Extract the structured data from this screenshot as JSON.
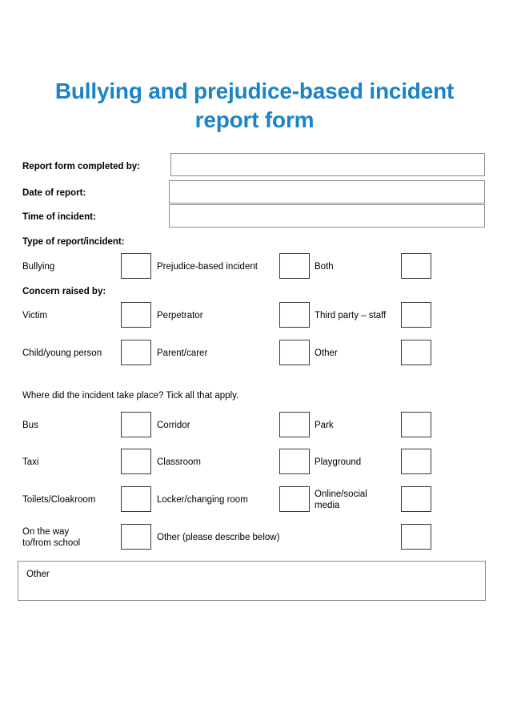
{
  "document": {
    "title_line_1": "Bullying and prejudice-based incident",
    "title_line_2": "report form",
    "title_color": "#1b83c6"
  },
  "header_fields": [
    {
      "label": "Report form completed by:",
      "value": "",
      "placeholder": ""
    },
    {
      "label": "Date of report:",
      "value": "",
      "placeholder": ""
    },
    {
      "label": "Time of incident:",
      "value": "",
      "placeholder": ""
    }
  ],
  "sections": [
    {
      "heading": "Type of report/incident:",
      "rows": [
        {
          "cells": [
            {
              "label": "Bullying",
              "checked": false
            },
            {
              "label": "Prejudice-based incident",
              "checked": false
            },
            {
              "label": "Both",
              "checked": false
            }
          ]
        }
      ]
    },
    {
      "heading": "Concern raised by:",
      "rows": [
        {
          "cells": [
            {
              "label": "Victim",
              "checked": false
            },
            {
              "label": "Perpetrator",
              "checked": false
            },
            {
              "label": "Third party – staff",
              "checked": false
            }
          ]
        },
        {
          "cells": [
            {
              "label": "Child/young person",
              "checked": false
            },
            {
              "label": "Parent/carer",
              "checked": false
            },
            {
              "label": "Other",
              "checked": false
            }
          ]
        }
      ]
    },
    {
      "heading": "Where did the incident take place? Tick all that apply.",
      "heading_bold": false,
      "rows": [
        {
          "cells": [
            {
              "label": "Bus",
              "checked": false
            },
            {
              "label": "Corridor",
              "checked": false
            },
            {
              "label": "Park",
              "checked": false
            }
          ]
        },
        {
          "cells": [
            {
              "label": "Taxi",
              "checked": false
            },
            {
              "label": "Classroom",
              "checked": false
            },
            {
              "label": "Playground",
              "checked": false
            }
          ]
        },
        {
          "cells": [
            {
              "label": "Toilets/Cloakroom",
              "checked": false
            },
            {
              "label": "Locker/changing room",
              "checked": false
            },
            {
              "label": "Online/social\nmedia",
              "checked": false
            }
          ]
        },
        {
          "cells": [
            {
              "label": "On the way\nto/from school",
              "checked": false
            },
            {
              "label": "Other (please describe below)",
              "checked": false
            }
          ]
        }
      ]
    }
  ],
  "other_area": {
    "label": "Other",
    "value": ""
  }
}
